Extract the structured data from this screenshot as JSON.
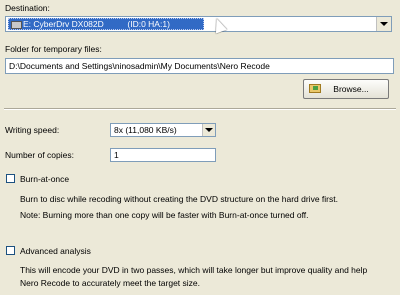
{
  "destination": {
    "label": "Destination:",
    "selected": "E: CyberDrv DX082D          (ID:0 HA:1)"
  },
  "temp_folder": {
    "label": "Folder for temporary files:",
    "value": "D:\\Documents and Settings\\ninosadmin\\My Documents\\Nero Recode",
    "browse_label": "Browse..."
  },
  "writing_speed": {
    "label": "Writing speed:",
    "selected": "8x (11,080 KB/s)"
  },
  "copies": {
    "label": "Number of copies:",
    "value": "1"
  },
  "burn_at_once": {
    "label": "Burn-at-once",
    "checked": false,
    "description": "Burn to disc while recoding without creating the DVD structure on the hard drive first.",
    "note": "Note: Burning more than one copy will be faster with Burn-at-once turned off."
  },
  "advanced_analysis": {
    "label": "Advanced analysis",
    "checked": false,
    "description_line1": "This will encode your DVD in two passes, which will take longer but improve quality and help",
    "description_line2": "Nero Recode to accurately meet the target size."
  }
}
